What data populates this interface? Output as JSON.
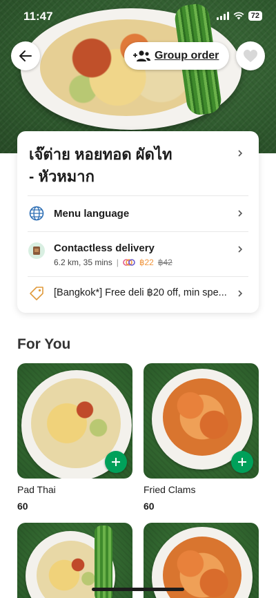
{
  "status_bar": {
    "time": "11:47",
    "battery": "72"
  },
  "header": {
    "group_order_label": "Group order"
  },
  "restaurant": {
    "name_line1": "เจ๊ต่าย หอยทอด ผัดไท",
    "name_line2": "- หัวหมาก"
  },
  "menu_language": {
    "label": "Menu language"
  },
  "delivery": {
    "title": "Contactless delivery",
    "distance_time": "6.2 km, 35 mins",
    "separator": "|",
    "fee_now": "฿22",
    "fee_was": "฿42"
  },
  "promo": {
    "text": "[Bangkok*] Free deli ฿20 off, min spe..."
  },
  "for_you": {
    "title": "For You",
    "items": [
      {
        "name": "Pad Thai",
        "price": "60"
      },
      {
        "name": "Fried Clams",
        "price": "60"
      }
    ]
  },
  "colors": {
    "accent_green": "#00a05a",
    "fee_orange": "#f0943b",
    "globe_blue": "#2e6fb5",
    "tag_orange": "#e09a3b"
  },
  "icons": [
    "back-arrow-icon",
    "add-group-icon",
    "heart-icon",
    "globe-icon",
    "delivery-box-icon",
    "discount-tag-icon",
    "chevron-right-icon",
    "plus-icon"
  ]
}
